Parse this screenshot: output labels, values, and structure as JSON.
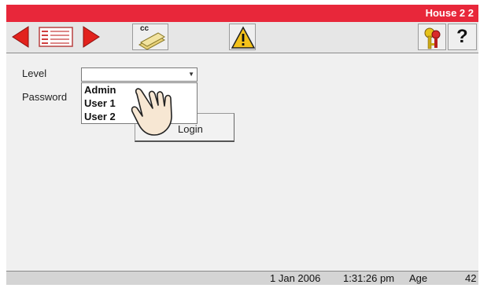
{
  "title": "House 2 2",
  "toolbar": {
    "prev_icon": "triangle-left-red",
    "list_icon": "menu-list",
    "next_icon": "triangle-right-red",
    "cc_label": "cc",
    "warning_icon": "warning-triangle",
    "keys_icon": "keys",
    "help_label": "?"
  },
  "form": {
    "level_label": "Level",
    "password_label": "Password",
    "level_value": "",
    "level_options": [
      "Admin",
      "User 1",
      "User 2"
    ],
    "login_label": "Login"
  },
  "status": {
    "date": "1 Jan 2006",
    "time": "1:31:26 pm",
    "age_label": "Age",
    "age_value": "42"
  },
  "colors": {
    "titlebar": "#e8273a",
    "arrow_red": "#e2221d",
    "warning_yellow": "#f4c21a"
  }
}
